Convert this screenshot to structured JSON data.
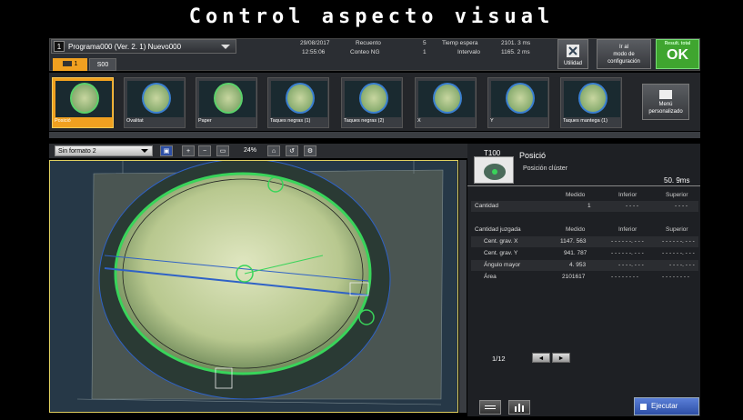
{
  "title": "Control aspecto visual",
  "header": {
    "program_number": "1",
    "program_name": "Programa000 (Ver. 2. 1) Nuevo000",
    "date": "29/08/2017",
    "time": "12:55:06",
    "recuento_label": "Recuento",
    "recuento_value": "5",
    "conteo_ng_label": "Conteo NG",
    "conteo_ng_value": "1",
    "tiemp_espera_label": "Tiemp espera",
    "tiemp_espera_value": "2101. 3  ms",
    "intervalo_label": "Intervalo",
    "intervalo_value": "1165. 2  ms",
    "utilidad_label": "Utilidad",
    "config_label_1": "Ir al",
    "config_label_2": "modo de",
    "config_label_3": "configuración",
    "ok_small": "Result. total",
    "ok_label": "OK",
    "tab1_label": "1",
    "tab2_label": "S00"
  },
  "thumbnails": [
    {
      "label": "Posició",
      "selected": true
    },
    {
      "label": "Ovalitat",
      "selected": false
    },
    {
      "label": "Paper",
      "selected": false
    },
    {
      "label": "Taques negras (1)",
      "selected": false
    },
    {
      "label": "Taques negras (2)",
      "selected": false
    },
    {
      "label": "X",
      "selected": false
    },
    {
      "label": "Y",
      "selected": false
    },
    {
      "label": "Taques mantega (1)",
      "selected": false
    }
  ],
  "menu_button": {
    "line1": "Menú",
    "line2": "personalizado"
  },
  "toolbar": {
    "format_value": "Sin formato 2",
    "zoom_value": "24%"
  },
  "panel": {
    "tool_id": "T100",
    "tool_name": "Posició",
    "tool_sub": "Posición clúster",
    "time": "50. 9ms",
    "table1_headers": [
      "Medido",
      "Inferior",
      "Superior"
    ],
    "table1_rows": [
      {
        "name": "Cantidad",
        "medido": "1",
        "inferior": "- - - -",
        "superior": "- - - -"
      }
    ],
    "table2_title": "Cantidad juzgada",
    "table2_headers": [
      "Medido",
      "Inferior",
      "Superior"
    ],
    "table2_rows": [
      {
        "name": "Cent. grav. X",
        "medido": "1147. 563",
        "inferior": "- - - - - -. - - -",
        "superior": "- - - - - -. - - -"
      },
      {
        "name": "Cent. grav. Y",
        "medido": "941. 787",
        "inferior": "- - - - - -. - - -",
        "superior": "- - - - - -. - - -"
      },
      {
        "name": "Ángulo mayor",
        "medido": "4. 953",
        "inferior": "- - - -. - - -",
        "superior": "- - - -. - - -"
      },
      {
        "name": "Área",
        "medido": "2101617",
        "inferior": "- - - - - - - -",
        "superior": "- - - - - - - -"
      }
    ],
    "page": "1/12",
    "prev": "◄",
    "next": "►",
    "run_label": "Ejecutar"
  }
}
